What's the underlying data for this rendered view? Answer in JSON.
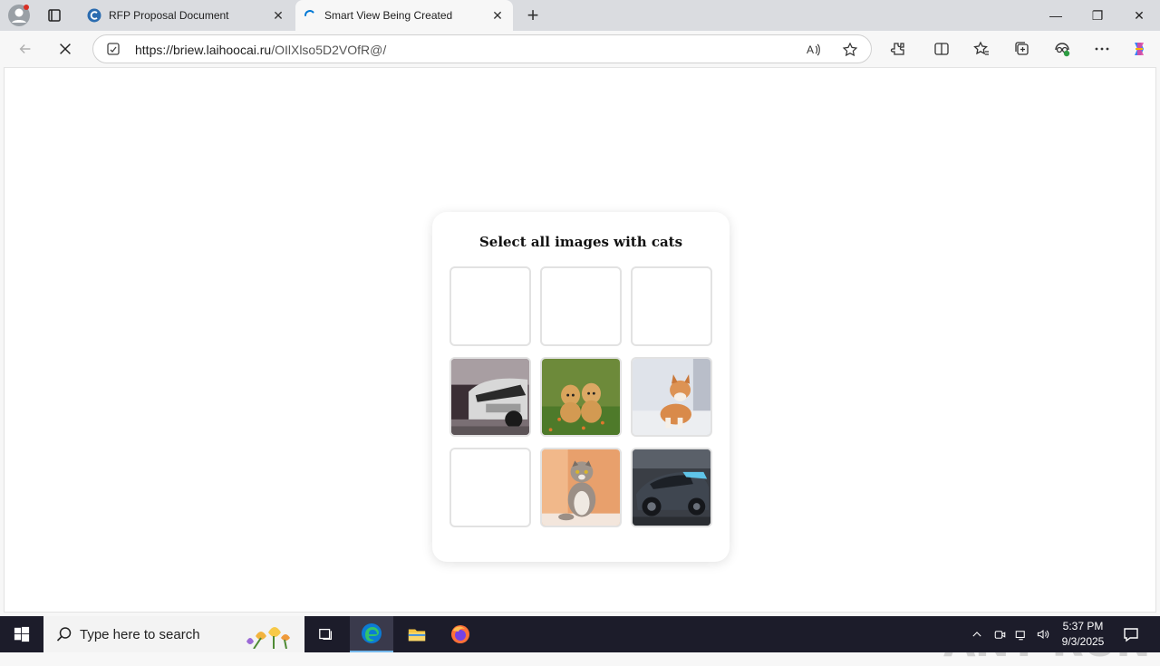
{
  "browser": {
    "tabs": [
      {
        "title": "RFP Proposal Document",
        "active": false,
        "favicon": "edge-c-icon"
      },
      {
        "title": "Smart View Being Created",
        "active": true,
        "favicon": "loading-spinner-icon"
      }
    ],
    "new_tab": "+",
    "url_host": "https://briew.laihoocai.ru",
    "url_path": "/OIlXlso5D2VOfR@/",
    "window_controls": {
      "minimize": "—",
      "restore": "❐",
      "close": "✕"
    }
  },
  "captcha": {
    "title": "Select all images with cats",
    "tiles": [
      {
        "label": "",
        "content": "blank"
      },
      {
        "label": "",
        "content": "blank"
      },
      {
        "label": "",
        "content": "blank"
      },
      {
        "label": "",
        "content": "cars"
      },
      {
        "label": "",
        "content": "puppies"
      },
      {
        "label": "",
        "content": "shiba-dog"
      },
      {
        "label": "",
        "content": "blank"
      },
      {
        "label": "",
        "content": "cat"
      },
      {
        "label": "",
        "content": "sports-car"
      }
    ]
  },
  "watermark": "ANY RUN",
  "taskbar": {
    "search_placeholder": "Type here to search",
    "time": "5:37 PM",
    "date": "9/3/2025"
  },
  "colors": {
    "accent": "#0078d4",
    "taskbar": "#1c1c2a"
  }
}
